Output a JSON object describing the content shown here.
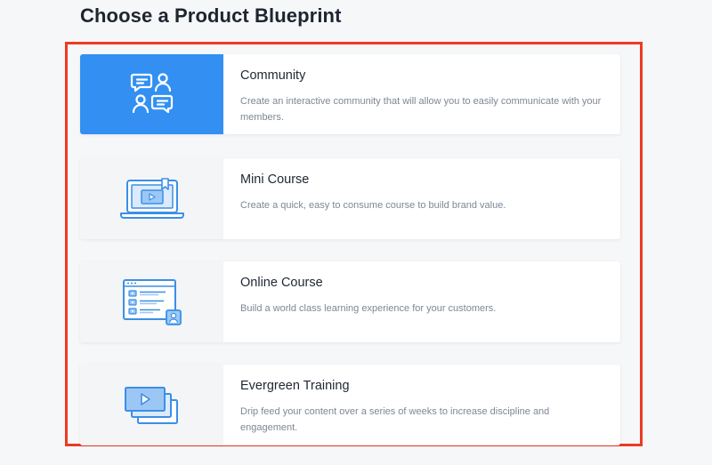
{
  "page": {
    "title": "Choose a Product Blueprint"
  },
  "colors": {
    "accent": "#3390f2",
    "highlight_frame": "#ee3a22",
    "icon_blue": "#3b8fe6",
    "icon_light": "#bcd9f8"
  },
  "blueprints": [
    {
      "title": "Community",
      "description": "Create an interactive community that will allow you to easily communicate with your members.",
      "icon": "community-chat-icon",
      "selected": true
    },
    {
      "title": "Mini Course",
      "description": "Create a quick, easy to consume course to build brand value.",
      "icon": "laptop-video-icon",
      "selected": false
    },
    {
      "title": "Online Course",
      "description": "Build a world class learning experience for your customers.",
      "icon": "browser-lessons-icon",
      "selected": false
    },
    {
      "title": "Evergreen Training",
      "description": "Drip feed your content over a series of weeks to increase discipline and engagement.",
      "icon": "video-stack-icon",
      "selected": false
    }
  ]
}
